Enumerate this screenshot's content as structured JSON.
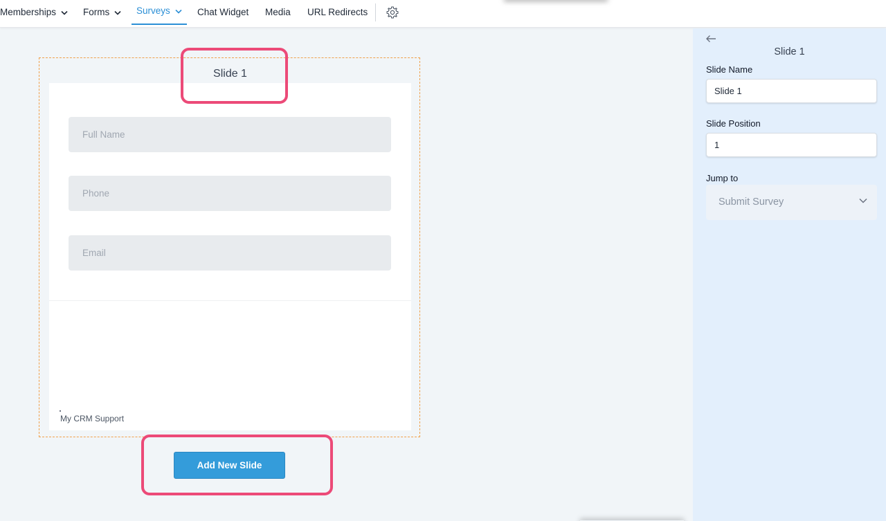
{
  "nav": {
    "items": [
      {
        "label": "Memberships",
        "has_dropdown": true,
        "active": false
      },
      {
        "label": "Forms",
        "has_dropdown": true,
        "active": false
      },
      {
        "label": "Surveys",
        "has_dropdown": true,
        "active": true
      },
      {
        "label": "Chat Widget",
        "has_dropdown": false,
        "active": false
      },
      {
        "label": "Media",
        "has_dropdown": false,
        "active": false
      },
      {
        "label": "URL Redirects",
        "has_dropdown": false,
        "active": false
      }
    ],
    "settings_icon": "gear-icon",
    "active_color": "#2b8fd6"
  },
  "slide": {
    "title": "Slide 1",
    "fields": [
      {
        "placeholder": "Full Name"
      },
      {
        "placeholder": "Phone"
      },
      {
        "placeholder": "Email"
      }
    ],
    "footer": "My CRM Support"
  },
  "actions": {
    "add_slide_label": "Add New Slide",
    "button_color": "#349cda"
  },
  "highlight_color": "#ec4a78",
  "panel": {
    "back_icon": "arrow-left-icon",
    "title": "Slide 1",
    "slide_name_label": "Slide Name",
    "slide_name_value": "Slide 1",
    "slide_position_label": "Slide Position",
    "slide_position_value": "1",
    "jump_to_label": "Jump to",
    "jump_to_value": "Submit Survey"
  }
}
